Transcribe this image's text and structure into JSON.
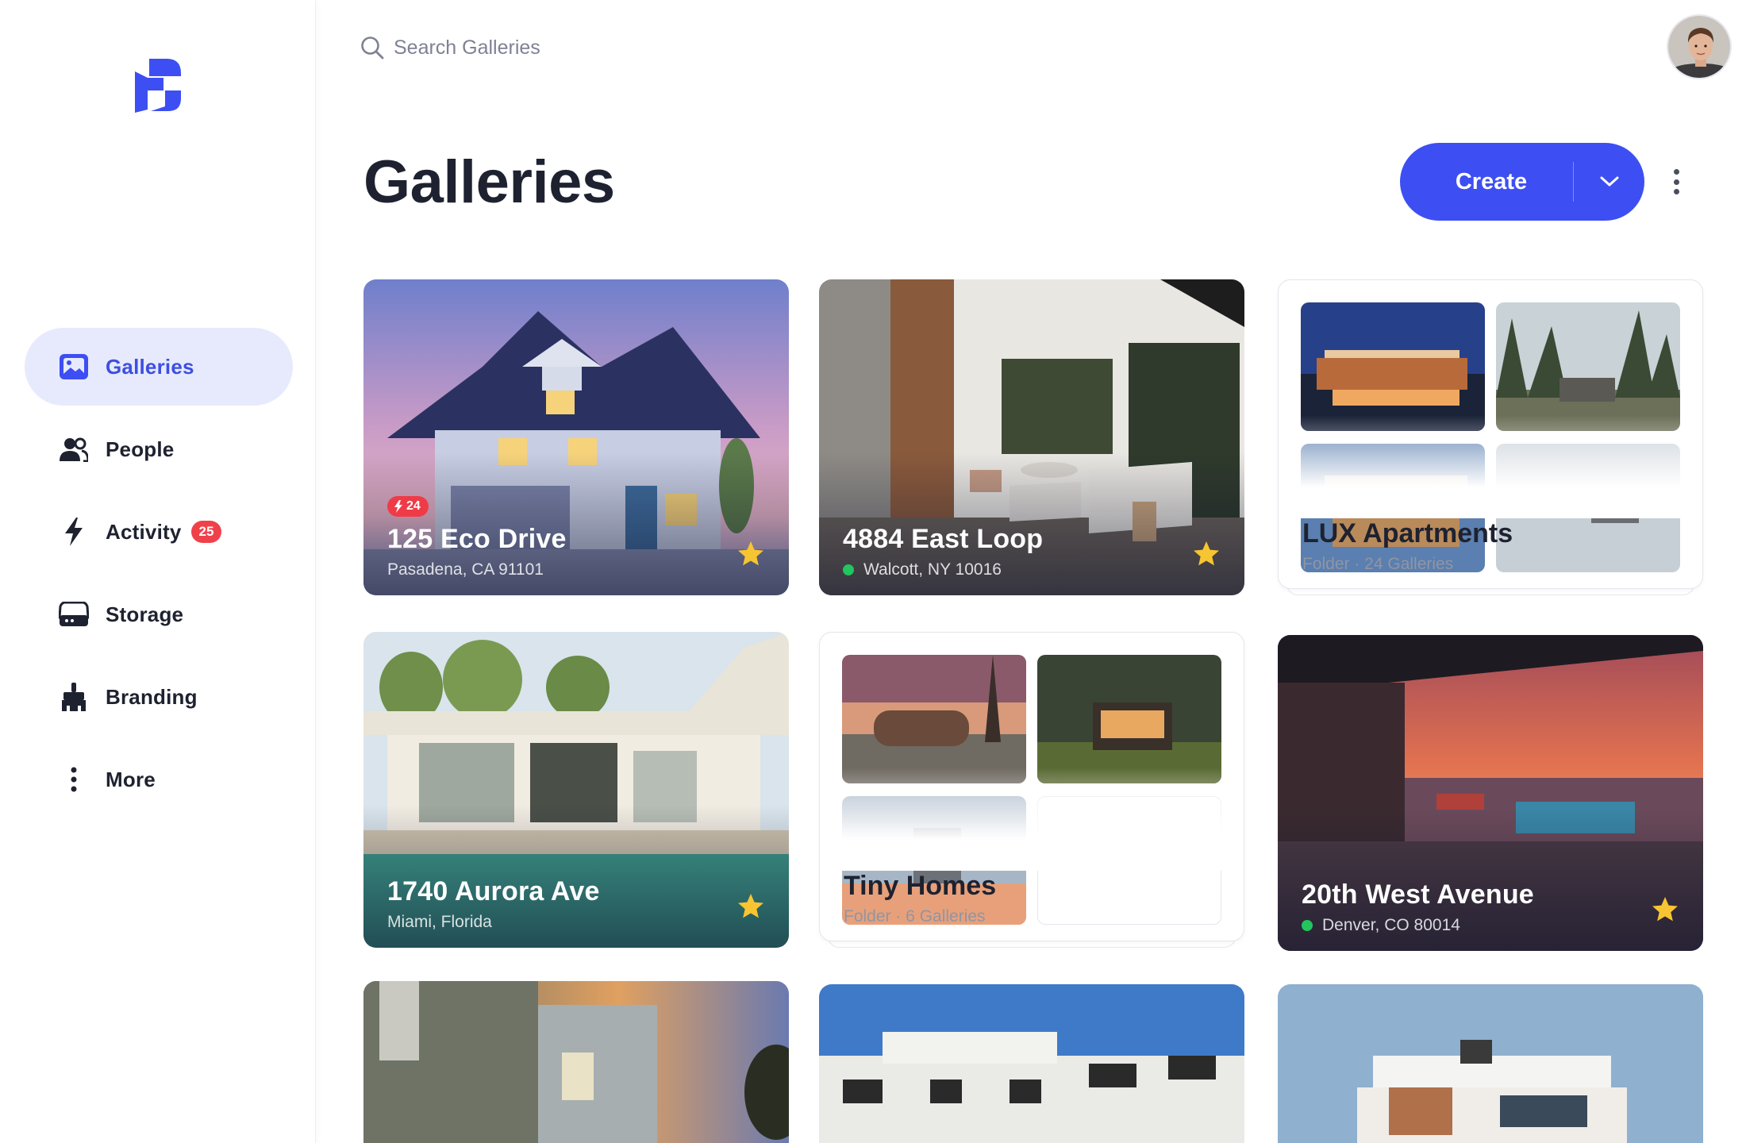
{
  "sidebar": {
    "items": [
      {
        "label": "Galleries",
        "icon": "gallery-icon",
        "active": true
      },
      {
        "label": "People",
        "icon": "people-icon"
      },
      {
        "label": "Activity",
        "icon": "bolt-icon",
        "badge": "25"
      },
      {
        "label": "Storage",
        "icon": "storage-icon"
      },
      {
        "label": "Branding",
        "icon": "brush-icon"
      },
      {
        "label": "More",
        "icon": "more-vertical-icon"
      }
    ]
  },
  "search": {
    "placeholder": "Search Galleries"
  },
  "header": {
    "title": "Galleries",
    "create_label": "Create"
  },
  "galleries": [
    {
      "type": "gallery",
      "title": "125 Eco Drive",
      "subtitle": "Pasadena, CA 91101",
      "badge": "24",
      "starred": true
    },
    {
      "type": "gallery",
      "title": "4884 East Loop",
      "subtitle": "Walcott, NY 10016",
      "live": true,
      "starred": true
    },
    {
      "type": "folder",
      "title": "LUX Apartments",
      "subtitle": "Folder · 24 Galleries"
    },
    {
      "type": "gallery",
      "title": "1740 Aurora Ave",
      "subtitle": "Miami, Florida",
      "starred": true
    },
    {
      "type": "folder",
      "title": "Tiny Homes",
      "subtitle": "Folder · 6 Galleries"
    },
    {
      "type": "gallery",
      "title": "20th West Avenue",
      "subtitle": "Denver, CO 80014",
      "live": true,
      "starred": true
    }
  ],
  "colors": {
    "accent": "#3d4ff2",
    "active_bg": "#e7eafd",
    "badge": "#f0414b",
    "live": "#22c55e",
    "star": "#f7c531"
  }
}
